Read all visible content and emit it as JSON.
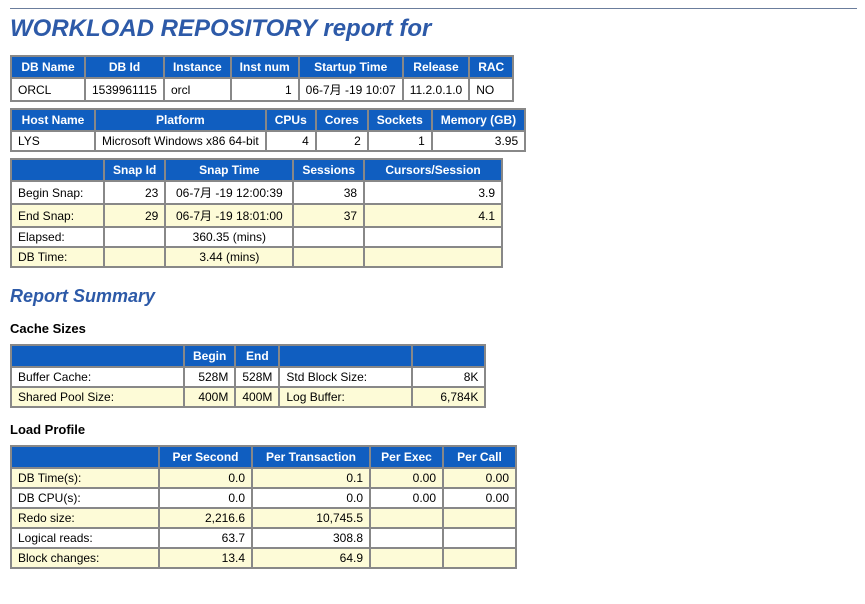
{
  "title": "WORKLOAD REPOSITORY report for",
  "table_db": {
    "headers": [
      "DB Name",
      "DB Id",
      "Instance",
      "Inst num",
      "Startup Time",
      "Release",
      "RAC"
    ],
    "row": [
      "ORCL",
      "1539961115",
      "orcl",
      "1",
      "06-7月 -19 10:07",
      "11.2.0.1.0",
      "NO"
    ]
  },
  "table_host": {
    "headers": [
      "Host Name",
      "Platform",
      "CPUs",
      "Cores",
      "Sockets",
      "Memory (GB)"
    ],
    "row": [
      "LYS",
      "Microsoft Windows x86 64-bit",
      "4",
      "2",
      "1",
      "3.95"
    ]
  },
  "table_snap": {
    "headers": [
      "",
      "Snap Id",
      "Snap Time",
      "Sessions",
      "Cursors/Session"
    ],
    "rows": [
      {
        "label": "Begin Snap:",
        "snapid": "23",
        "time": "06-7月 -19 12:00:39",
        "sessions": "38",
        "cps": "3.9"
      },
      {
        "label": "End Snap:",
        "snapid": "29",
        "time": "06-7月 -19 18:01:00",
        "sessions": "37",
        "cps": "4.1"
      },
      {
        "label": "Elapsed:",
        "snapid": "",
        "time": "360.35 (mins)",
        "sessions": "",
        "cps": ""
      },
      {
        "label": "DB Time:",
        "snapid": "",
        "time": "3.44 (mins)",
        "sessions": "",
        "cps": ""
      }
    ]
  },
  "summary_title": "Report Summary",
  "cache_sizes_title": "Cache Sizes",
  "table_cache": {
    "headers": [
      "",
      "Begin",
      "End",
      "",
      ""
    ],
    "rows": [
      {
        "a": "Buffer Cache:",
        "b": "528M",
        "c": "528M",
        "d": "Std Block Size:",
        "e": "8K"
      },
      {
        "a": "Shared Pool Size:",
        "b": "400M",
        "c": "400M",
        "d": "Log Buffer:",
        "e": "6,784K"
      }
    ]
  },
  "load_profile_title": "Load Profile",
  "table_load": {
    "headers": [
      "",
      "Per Second",
      "Per Transaction",
      "Per Exec",
      "Per Call"
    ],
    "rows": [
      {
        "a": "DB Time(s):",
        "ps": "0.0",
        "pt": "0.1",
        "pe": "0.00",
        "pc": "0.00"
      },
      {
        "a": "DB CPU(s):",
        "ps": "0.0",
        "pt": "0.0",
        "pe": "0.00",
        "pc": "0.00"
      },
      {
        "a": "Redo size:",
        "ps": "2,216.6",
        "pt": "10,745.5",
        "pe": "",
        "pc": ""
      },
      {
        "a": "Logical reads:",
        "ps": "63.7",
        "pt": "308.8",
        "pe": "",
        "pc": ""
      },
      {
        "a": "Block changes:",
        "ps": "13.4",
        "pt": "64.9",
        "pe": "",
        "pc": ""
      }
    ]
  }
}
